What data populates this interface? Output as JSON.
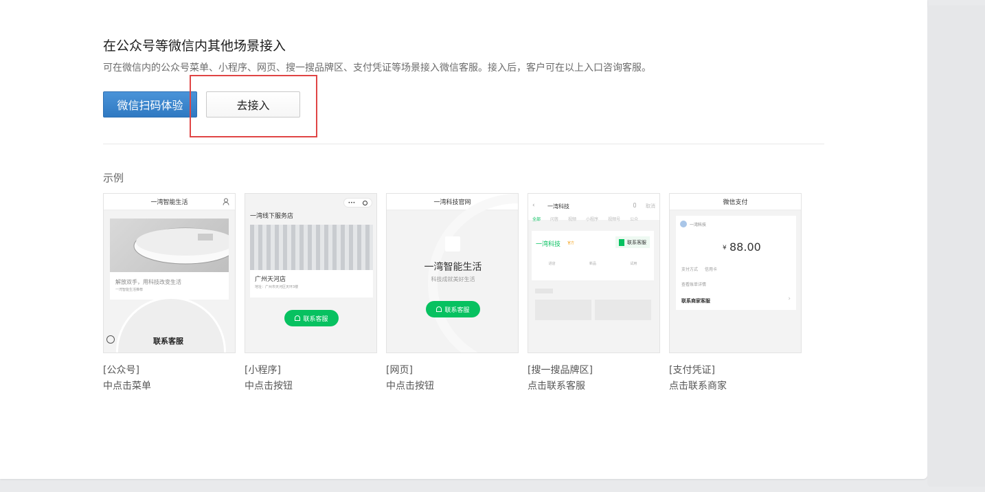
{
  "section": {
    "title": "在公众号等微信内其他场景接入",
    "description": "可在微信内的公众号菜单、小程序、网页、搜一搜品牌区、支付凭证等场景接入微信客服。接入后，客户可在以上入口咨询客服。",
    "scan_button": "微信扫码体验",
    "connect_button": "去接入"
  },
  "examples": {
    "label": "示例",
    "items": [
      {
        "tag": "[公众号]",
        "desc": "中点击菜单"
      },
      {
        "tag": "[小程序]",
        "desc": "中点击按钮"
      },
      {
        "tag": "[网页]",
        "desc": "中点击按钮"
      },
      {
        "tag": "[搜一搜品牌区]",
        "desc": "点击联系客服"
      },
      {
        "tag": "[支付凭证]",
        "desc": "点击联系商家"
      }
    ]
  },
  "mock": {
    "oa": {
      "bar": "一湾智能生活",
      "caption": "解放双手，用科技改变生活",
      "sub": "一湾智能生活推荐",
      "menu": "联系客服"
    },
    "mp": {
      "store": "一湾线下服务店",
      "shop": "广州天河店",
      "addr": "地址：广州市天河区天环3楼",
      "btn": "联系客服",
      "dots": "•••"
    },
    "web": {
      "bar": "一湾科技官网",
      "brand": "一湾智能生活",
      "slogan": "科技成就美好生活",
      "btn": "联系客服"
    },
    "search": {
      "bar": "一湾科技",
      "cancel": "取消",
      "tabs": [
        "全部",
        "问答",
        "视频",
        "小程序",
        "视频号",
        "公众"
      ],
      "brand": "一湾科技",
      "badge": "官方",
      "btn": "联系客服",
      "icons": [
        "进店",
        "新品",
        "试用"
      ]
    },
    "pay": {
      "bar": "微信支付",
      "merchant": "一湾科技",
      "currency": "¥",
      "amount": "88.00",
      "method_label": "支付方式",
      "method_value": "信用卡",
      "bill": "查看账单详情",
      "contact": "联系商家客服"
    }
  },
  "colors": {
    "primary": "#2f79c2",
    "highlight": "#e04444",
    "wechat_green": "#07c160"
  }
}
